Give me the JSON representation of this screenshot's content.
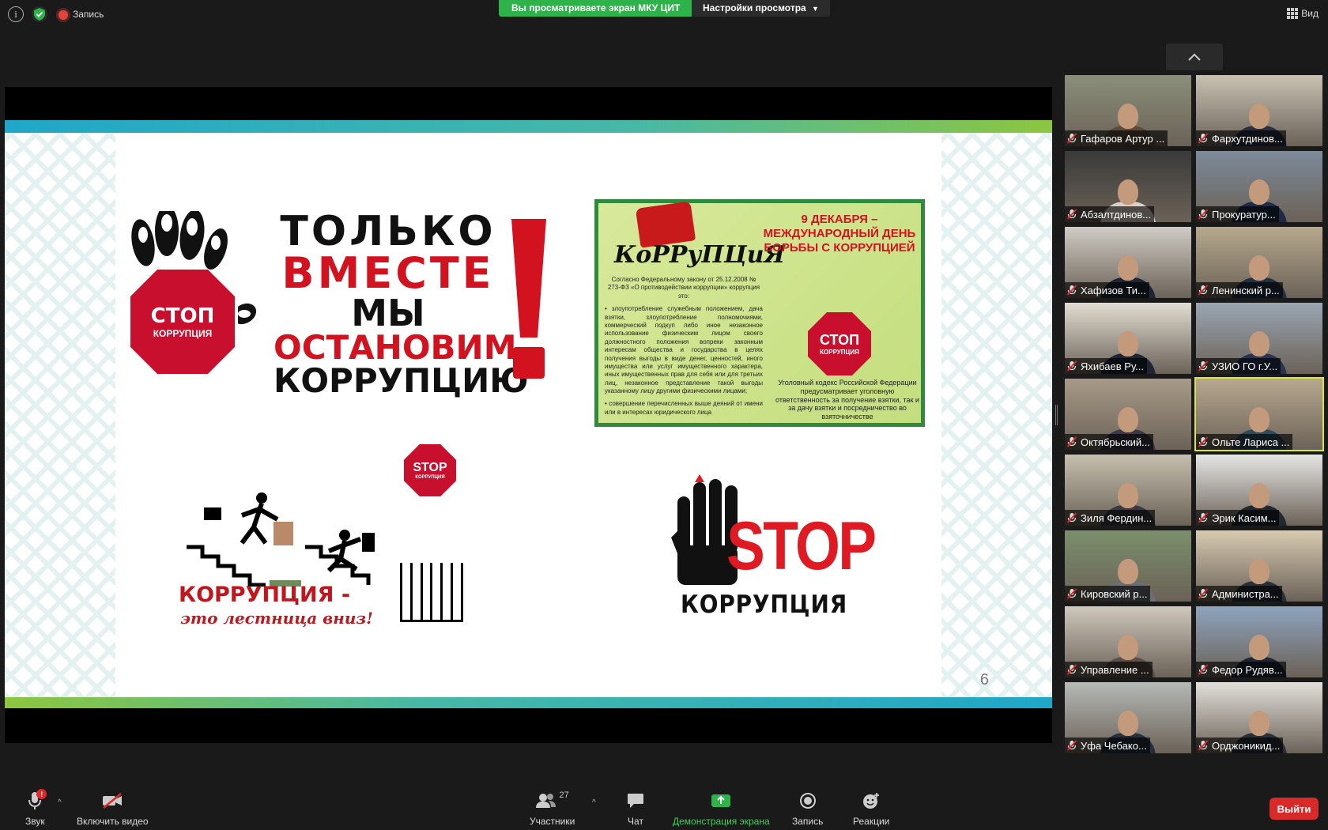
{
  "top": {
    "recording_label": "Запись",
    "share_banner": "Вы просматриваете экран МКУ ЦИТ",
    "view_options": "Настройки просмотра",
    "view_button": "Вид"
  },
  "slide": {
    "page_number": "6",
    "poster1": {
      "stop_big": "СТОП",
      "stop_small": "КОРРУПЦИЯ",
      "line1": "ТОЛЬКО",
      "line2": "ВМЕСТЕ",
      "line3": "МЫ",
      "line4": "ОСТАНОВИМ",
      "line5": "КОРРУПЦИЮ"
    },
    "poster2": {
      "word": "КоРРуПЦиЯ",
      "title": "9 ДЕКАБРЯ – МЕЖДУНАРОДНЫЙ ДЕНЬ БОРЬБЫ С КОРРУПЦИЕЙ",
      "law": "Согласно Федеральному закону от 25.12.2008 № 273-ФЗ «О противодействии коррупции» коррупция это:",
      "bullet1": "• злоупотребление служебным положением, дача взятки, злоупотребление полномочиями, коммерческий подкуп либо иное незаконное использование физическим лицом своего должностного положения вопреки законным интересам общества и государства в целях получения выгоды в виде денег, ценностей, иного имущества или услуг имущественного характера, иных имущественных прав для себя или для третьих лиц, незаконное представление такой выгоды указанному лицу другими физическими лицами;",
      "bullet2": "• совершение перечисленных выше деяний от имени или в интересах юридического лица",
      "footer": "Уголовный кодекс Российской Федерации предусматривает уголовную ответственность за получение взятки, так и за дачу взятки и посредничество во взяточничестве",
      "stop_big": "СТОП",
      "stop_small": "КОРРУПЦИЯ"
    },
    "poster3": {
      "stop_big": "STOP",
      "stop_small": "КОРРУПЦИЯ",
      "line1": "КОРРУПЦИЯ -",
      "line2": "это лестница вниз!"
    },
    "poster4": {
      "stop": "STOP",
      "word": "КОРРУПЦИЯ"
    }
  },
  "participants": [
    {
      "name": "Гафаров Артур ..."
    },
    {
      "name": "Фархутдинов..."
    },
    {
      "name": "Абзалтдинов..."
    },
    {
      "name": "Прокуратур..."
    },
    {
      "name": "Хафизов Ти..."
    },
    {
      "name": "Ленинский р..."
    },
    {
      "name": "Яхибаев Ру..."
    },
    {
      "name": "УЗИО ГО г.У..."
    },
    {
      "name": "Октябрьский..."
    },
    {
      "name": "Ольте Лариса ..."
    },
    {
      "name": "Зиля Фердин..."
    },
    {
      "name": "Эрик Касим..."
    },
    {
      "name": "Кировский р..."
    },
    {
      "name": "Администра..."
    },
    {
      "name": "Управление ..."
    },
    {
      "name": "Федор Рудяв..."
    },
    {
      "name": "Уфа Чебако..."
    },
    {
      "name": "Орджоникид..."
    }
  ],
  "toolbar": {
    "audio": "Звук",
    "audio_badge": "!",
    "video": "Включить видео",
    "participants": "Участники",
    "participants_count": "27",
    "chat": "Чат",
    "share": "Демонстрация экрана",
    "record": "Запись",
    "reactions": "Реакции",
    "leave": "Выйти"
  },
  "colors": {
    "share_green": "#2db34a",
    "leave_red": "#d92a2a",
    "active_speaker": "#d6e63c"
  }
}
